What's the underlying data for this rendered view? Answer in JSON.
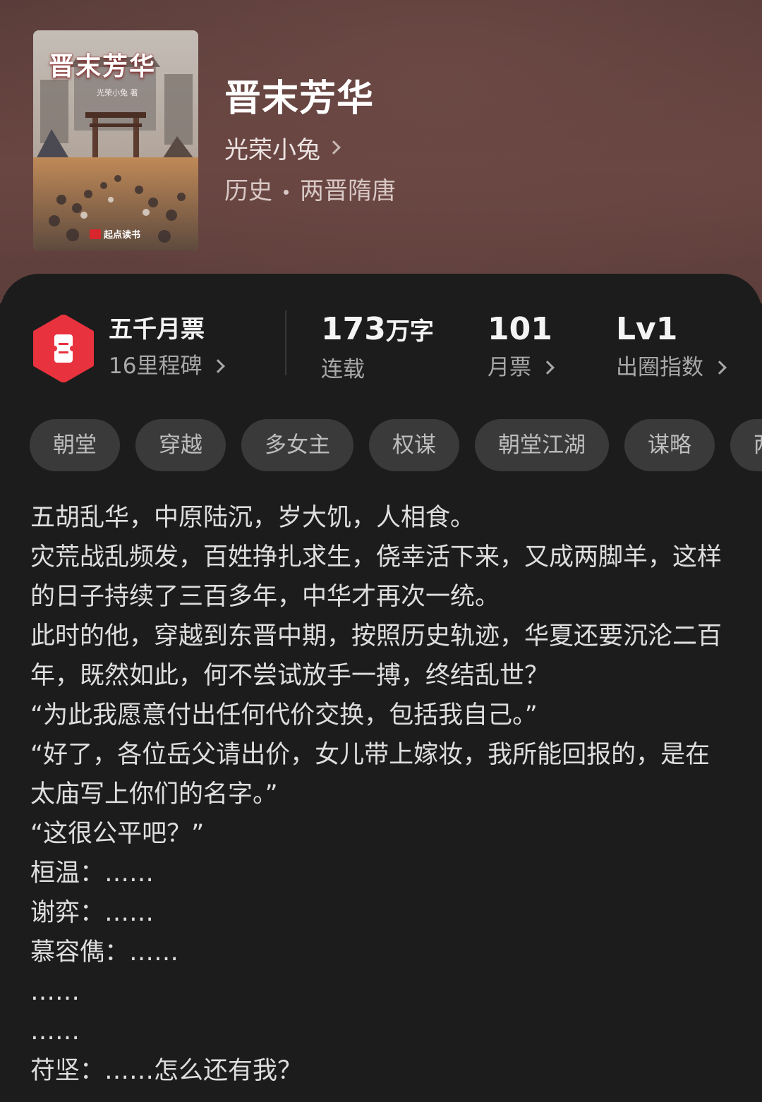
{
  "book": {
    "cover": {
      "title_art": "晋末芳华",
      "author_art": "光荣小兔 著",
      "brand": "起点读书"
    },
    "title": "晋末芳华",
    "author": "光荣小兔",
    "category": "历史",
    "subcategory": "两晋隋唐"
  },
  "stats": {
    "milestone": {
      "title": "五千月票",
      "subtitle": "16里程碑"
    },
    "word_count": {
      "value": "173",
      "unit": "万字",
      "label": "连载"
    },
    "monthly_votes": {
      "value": "101",
      "label": "月票"
    },
    "breakout": {
      "value": "Lv1",
      "label": "出圈指数"
    }
  },
  "tags": [
    "朝堂",
    "穿越",
    "多女主",
    "权谋",
    "朝堂江湖",
    "谋略",
    "两晋"
  ],
  "synopsis": [
    "五胡乱华，中原陆沉，岁大饥，人相食。",
    "灾荒战乱频发，百姓挣扎求生，侥幸活下来，又成两脚羊，这样的日子持续了三百多年，中华才再次一统。",
    "此时的他，穿越到东晋中期，按照历史轨迹，华夏还要沉沦二百年，既然如此，何不尝试放手一搏，终结乱世？",
    "“为此我愿意付出任何代价交换，包括我自己。”",
    "“好了，各位岳父请出价，女儿带上嫁妆，我所能回报的，是在太庙写上你们的名字。”",
    "“这很公平吧？”",
    "桓温：……",
    "谢弈：……",
    "慕容儁：……",
    "……",
    "……",
    "苻坚：……怎么还有我？"
  ],
  "colors": {
    "header_bg": "#5a3d3a",
    "card_bg": "#1c1c1c",
    "tag_bg": "#3a3a3a",
    "ticket_red": "#e8323e"
  },
  "icons": {
    "milestone": "ticket-icon",
    "chevron": "chevron-right-icon"
  }
}
